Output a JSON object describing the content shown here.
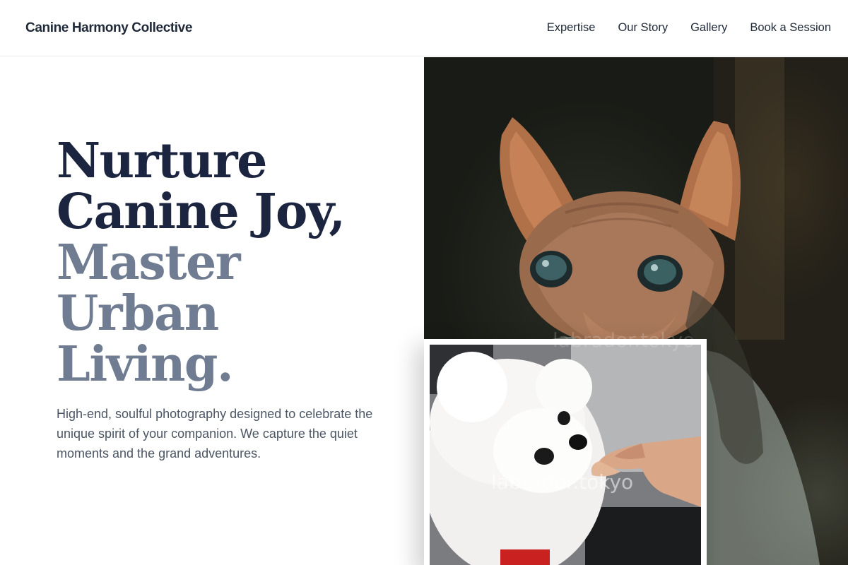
{
  "header": {
    "brand": "Canine Harmony Collective",
    "nav": [
      {
        "label": "Expertise"
      },
      {
        "label": "Our Story"
      },
      {
        "label": "Gallery"
      },
      {
        "label": "Book a Session"
      }
    ]
  },
  "hero": {
    "title_lines": [
      "Nurture",
      "Canine Joy,",
      "Master",
      "Urban",
      "Living."
    ],
    "description": "High-end, soulful photography designed to celebrate the unique spirit of your companion. We capture the quiet moments and the grand adventures."
  },
  "images": {
    "main_watermark": "labrador.tokyo",
    "inset_watermark": "labrador.tokyo"
  },
  "colors": {
    "title_dark": "#1c2540",
    "title_muted": "#6f7c91",
    "body_text": "#4b5563"
  }
}
